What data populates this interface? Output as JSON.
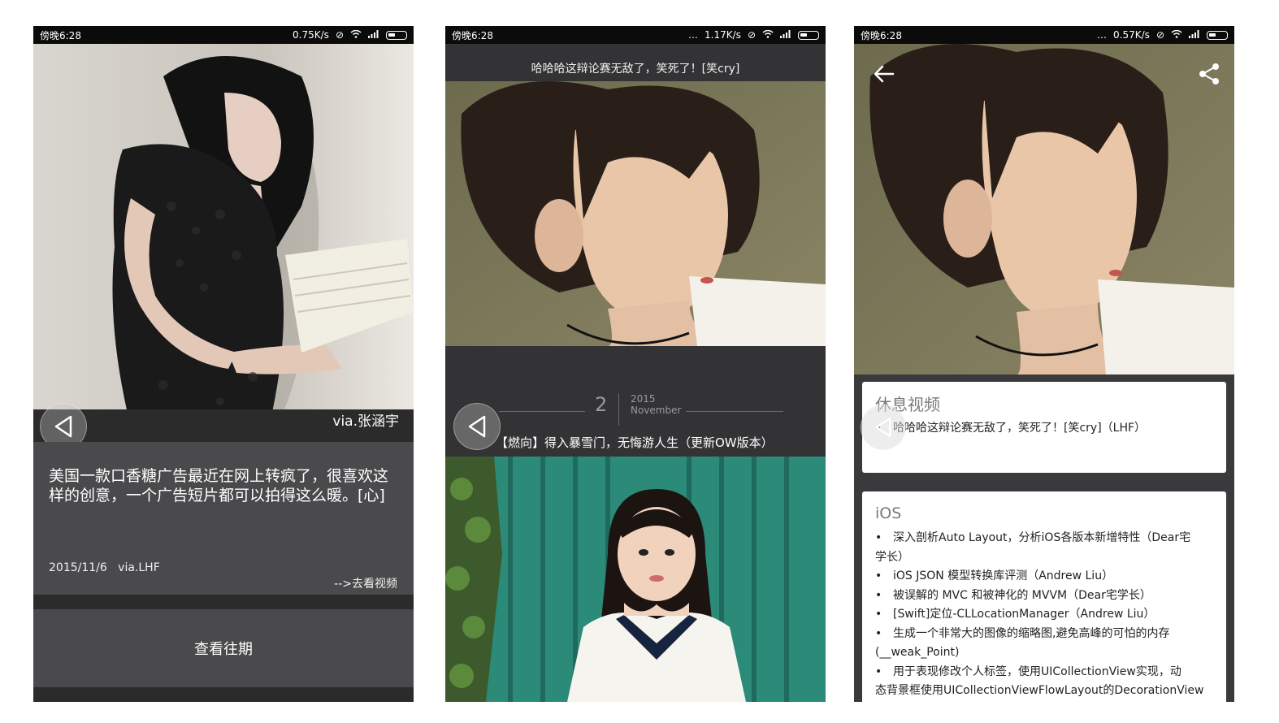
{
  "screens": [
    {
      "status": {
        "time": "傍晚6:28",
        "speed": "0.75K/s"
      },
      "photo_caption": "via.张涵宇",
      "card": {
        "text": "美国一款口香糖广告最近在网上转疯了，很喜欢这样的创意，一个广告短片都可以拍得这么暖。[心]",
        "date": "2015/11/6",
        "via": "via.LHF",
        "link": "-->去看视频"
      },
      "archive_button": "查看往期"
    },
    {
      "status": {
        "time": "傍晚6:28",
        "speed": "1.17K/s"
      },
      "title": "哈哈哈这辩论赛无敌了，笑死了！[笑cry]",
      "date": {
        "day": "2",
        "year": "2015",
        "month": "November"
      },
      "caption": "【燃向】得入暴雪门，无悔游人生（更新OW版本）"
    },
    {
      "status": {
        "time": "傍晚6:28",
        "speed": "0.57K/s"
      },
      "sections": [
        {
          "title": "休息视频",
          "items": [
            "哈哈哈这辩论赛无敌了，笑死了！[笑cry]（LHF）"
          ]
        },
        {
          "title": "iOS",
          "items": [
            "深入剖析Auto Layout，分析iOS各版本新增特性（Dear宅",
            "学长）",
            "iOS JSON 模型转换库评测（Andrew Liu）",
            "被误解的 MVC 和被神化的 MVVM（Dear宅学长）",
            "[Swift]定位-CLLocationManager（Andrew Liu）",
            "生成一个非常大的图像的缩略图,避免高峰的可怕的内存",
            "(__weak_Point)",
            "用于表现修改个人标签，使用UICollectionView实现，动",
            "态背景框使用UICollectionViewFlowLayout的DecorationView"
          ]
        }
      ]
    }
  ],
  "icons": [
    "back-triangle-icon",
    "arrow-left-icon",
    "share-icon",
    "wifi-icon",
    "signal-icon",
    "battery-icon",
    "mute-icon"
  ],
  "colors": {
    "statusbar": "#0b0b0b",
    "card": "#4a4a4c",
    "panel": "#333335"
  }
}
